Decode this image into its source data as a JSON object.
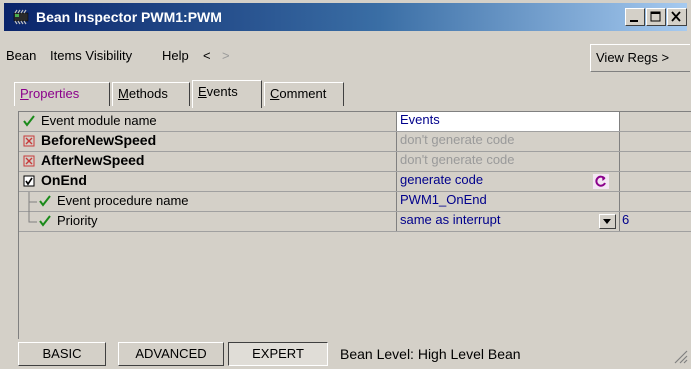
{
  "window": {
    "title": "Bean Inspector PWM1:PWM",
    "icon": "bean-chip-icon",
    "controls": [
      "minimize-icon",
      "maximize-icon",
      "close-icon"
    ]
  },
  "menu": {
    "items": [
      "Bean",
      "Items Visibility",
      "Help"
    ],
    "back_arrow": "<",
    "forward_arrow": ">",
    "view_regs": "View Regs >"
  },
  "tabs": [
    {
      "label": "Properties",
      "accel": "P",
      "rest": "roperties"
    },
    {
      "label": "Methods",
      "accel": "M",
      "rest": "ethods"
    },
    {
      "label": "Events",
      "accel": "E",
      "rest": "vents"
    },
    {
      "label": "Comment",
      "accel": "C",
      "rest": "omment"
    }
  ],
  "active_tab": "Events",
  "rows": [
    {
      "name": "Event module name",
      "value": "Events",
      "extra": "",
      "icon": "check-icon",
      "bold": false,
      "value_state": "editable"
    },
    {
      "name": "BeforeNewSpeed",
      "value": "don't generate code",
      "extra": "",
      "icon": "disabled-box-icon",
      "bold": true,
      "value_state": "disabled"
    },
    {
      "name": "AfterNewSpeed",
      "value": "don't generate code",
      "extra": "",
      "icon": "disabled-box-icon",
      "bold": true,
      "value_state": "disabled"
    },
    {
      "name": "OnEnd",
      "value": "generate code",
      "extra": "",
      "icon": "checked-box-icon",
      "bold": true,
      "value_state": "enabled"
    },
    {
      "name": "Event procedure name",
      "value": "PWM1_OnEnd",
      "extra": "",
      "icon": "check-icon",
      "bold": false,
      "value_state": "enabled"
    },
    {
      "name": "Priority",
      "value": "same as interrupt",
      "extra": "6",
      "icon": "check-icon",
      "bold": false,
      "value_state": "enabled"
    }
  ],
  "statusbar": {
    "levels": [
      "BASIC",
      "ADVANCED",
      "EXPERT"
    ],
    "selected_level": "EXPERT",
    "bean_level": "Bean Level: High Level Bean"
  },
  "colors": {
    "title_start": "#0a246a",
    "title_end": "#a6caf0",
    "value_text": "#00008b",
    "disabled_text": "#9a9a9a",
    "check_green": "#1a8a1a",
    "disabled_red": "#c83a3a",
    "properties_tab_text": "#8b008b"
  }
}
